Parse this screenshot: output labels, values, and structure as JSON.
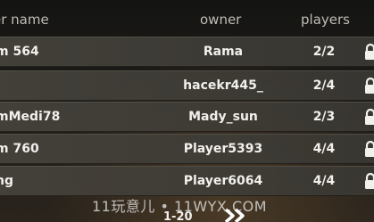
{
  "table": {
    "headers": {
      "room_name": "er name",
      "owner": "owner",
      "players": "players"
    },
    "rows": [
      {
        "room": "m 564",
        "owner": "Rama",
        "players": "2/2",
        "locked": true
      },
      {
        "room": "",
        "owner": "hacekr445_",
        "players": "2/4",
        "locked": true
      },
      {
        "room": "mMedi78",
        "owner": "Mady_sun",
        "players": "2/3",
        "locked": true
      },
      {
        "room": "m 760",
        "owner": "Player5393",
        "players": "4/4",
        "locked": true
      },
      {
        "room": "ng",
        "owner": "Player6064",
        "players": "4/4",
        "locked": true
      }
    ]
  },
  "pagination": {
    "range": "1-20",
    "next_icon": "double-chevron-right-icon"
  },
  "watermark": "11玩意儿 • 11WYX.COM",
  "lock_icon": "lock-icon"
}
